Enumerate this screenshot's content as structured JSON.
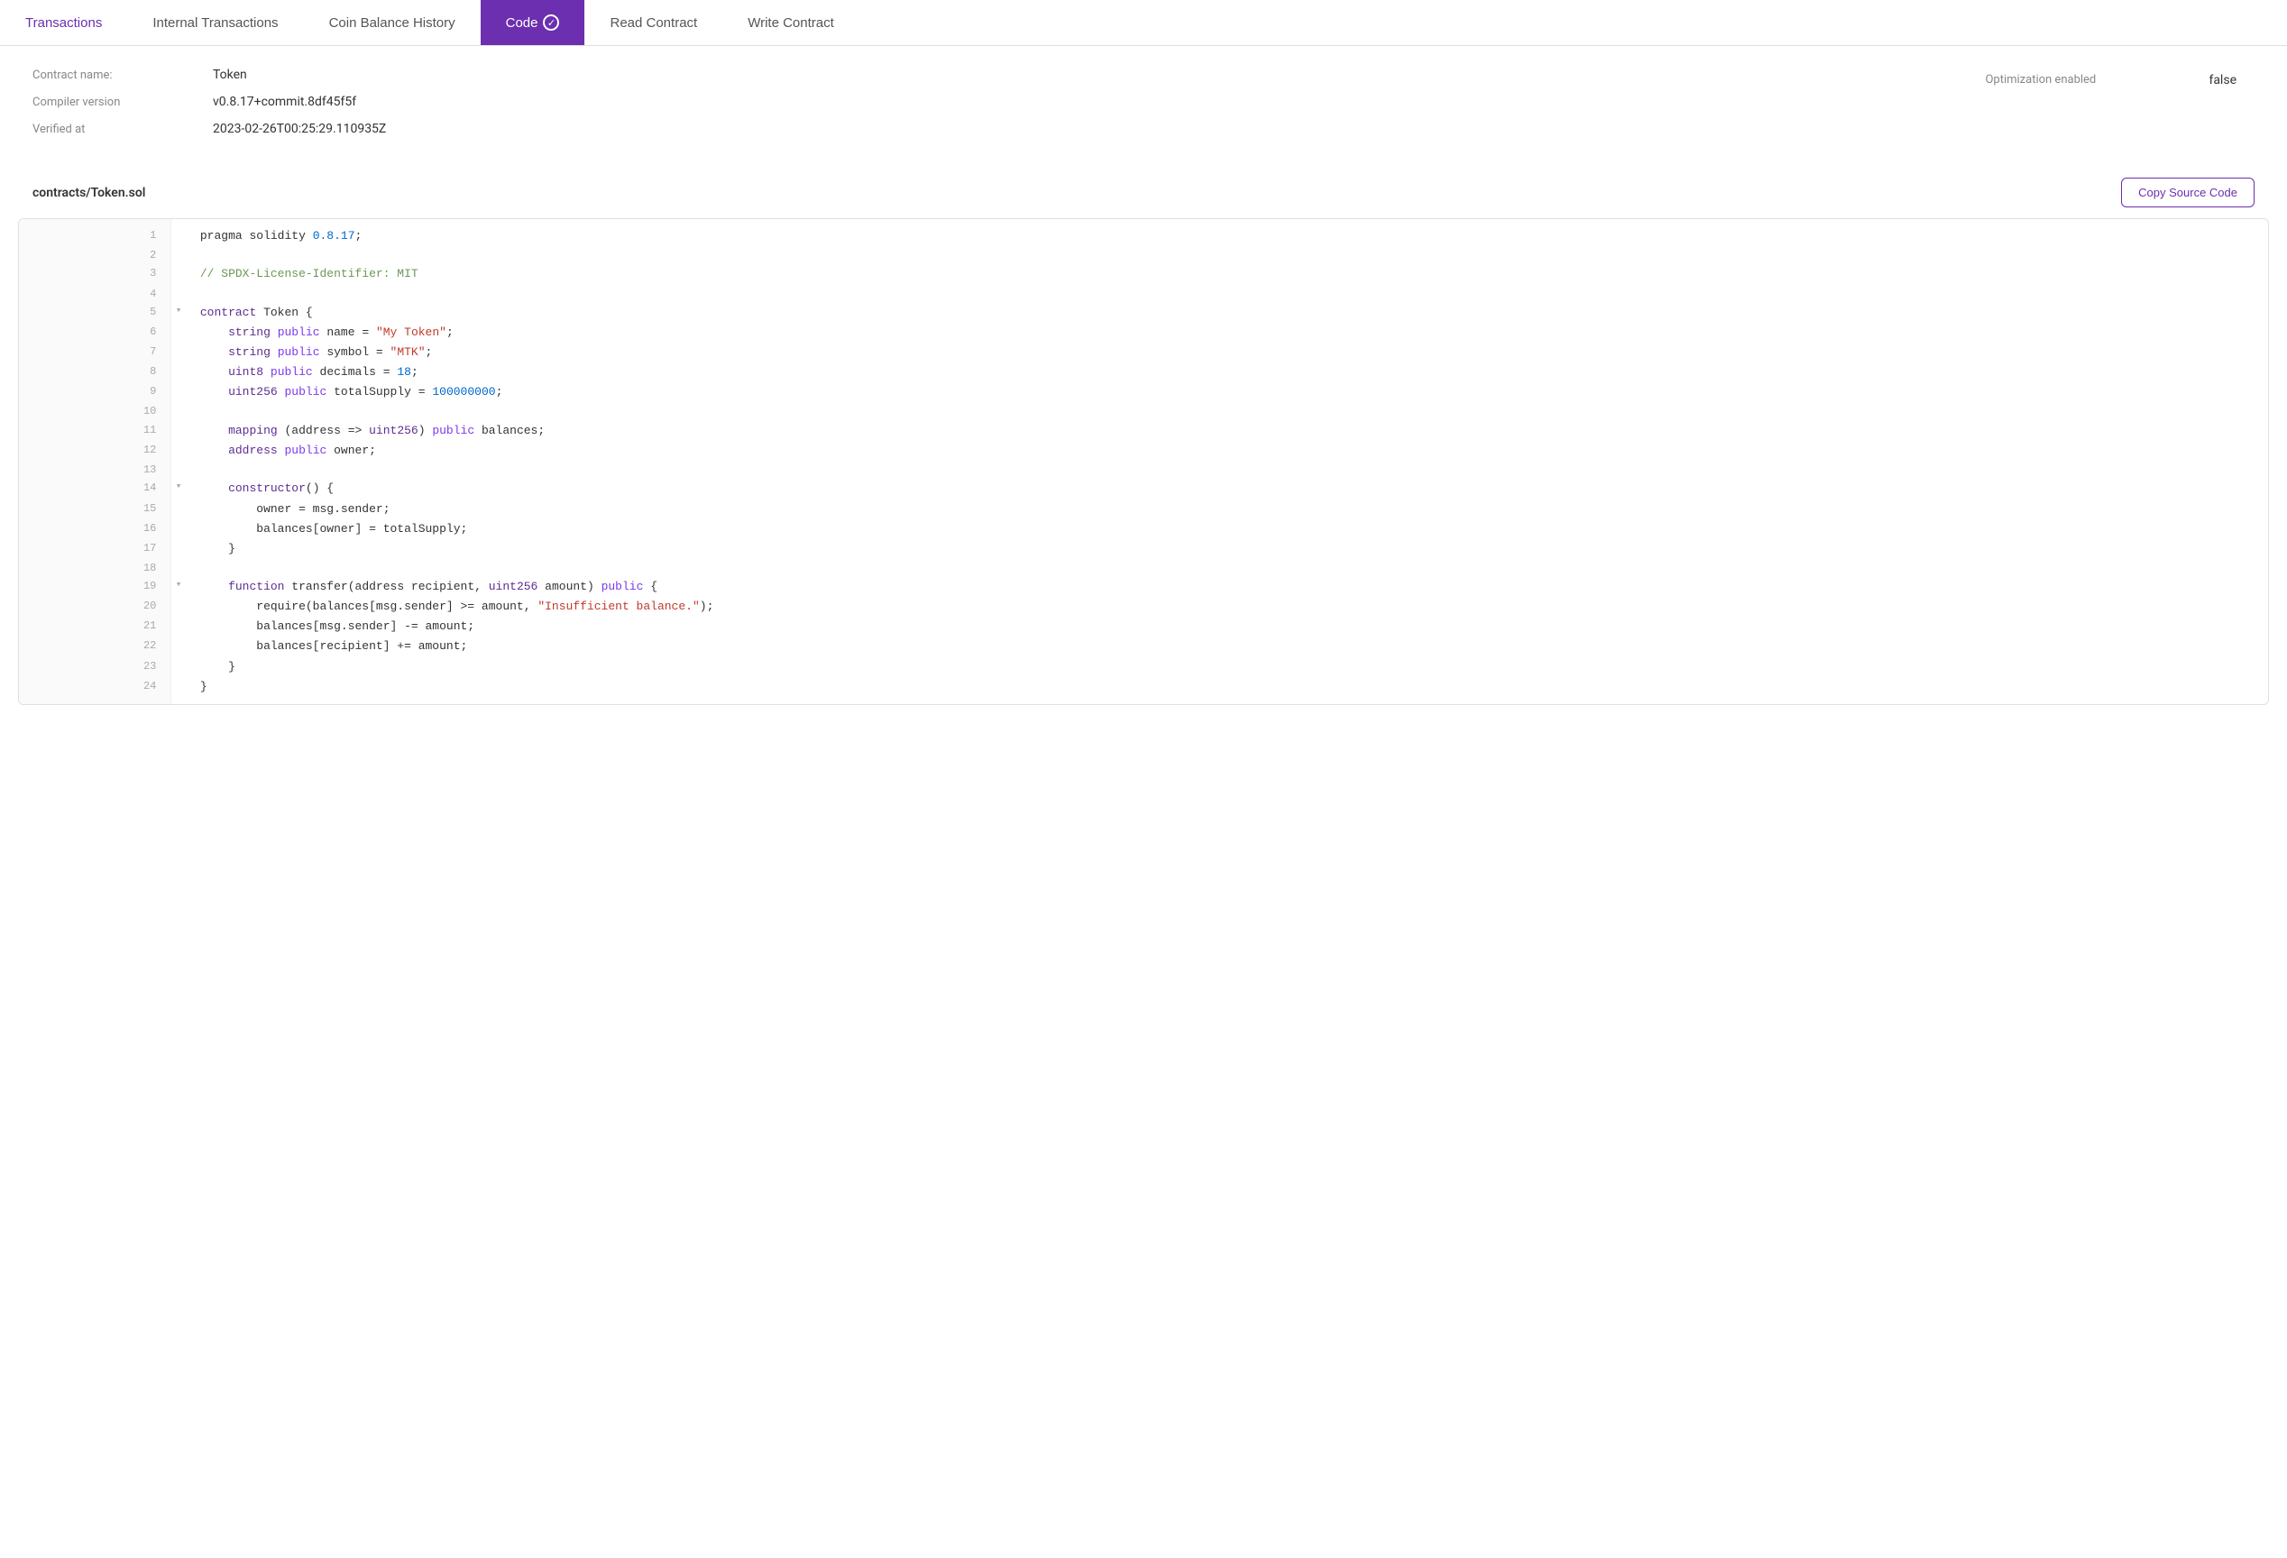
{
  "tabs": [
    {
      "id": "transactions",
      "label": "Transactions",
      "active": false
    },
    {
      "id": "internal-transactions",
      "label": "Internal Transactions",
      "active": false
    },
    {
      "id": "coin-balance-history",
      "label": "Coin Balance History",
      "active": false
    },
    {
      "id": "code",
      "label": "Code",
      "active": true,
      "icon": "check"
    },
    {
      "id": "read-contract",
      "label": "Read Contract",
      "active": false
    },
    {
      "id": "write-contract",
      "label": "Write Contract",
      "active": false
    }
  ],
  "contract": {
    "name_label": "Contract name:",
    "name_value": "Token",
    "compiler_label": "Compiler version",
    "compiler_value": "v0.8.17+commit.8df45f5f",
    "verified_label": "Verified at",
    "verified_value": "2023-02-26T00:25:29.110935Z",
    "optimization_label": "Optimization enabled",
    "optimization_value": "false"
  },
  "source": {
    "filename": "contracts/Token.sol",
    "copy_button_label": "Copy Source Code"
  },
  "colors": {
    "accent": "#6b2faf"
  }
}
